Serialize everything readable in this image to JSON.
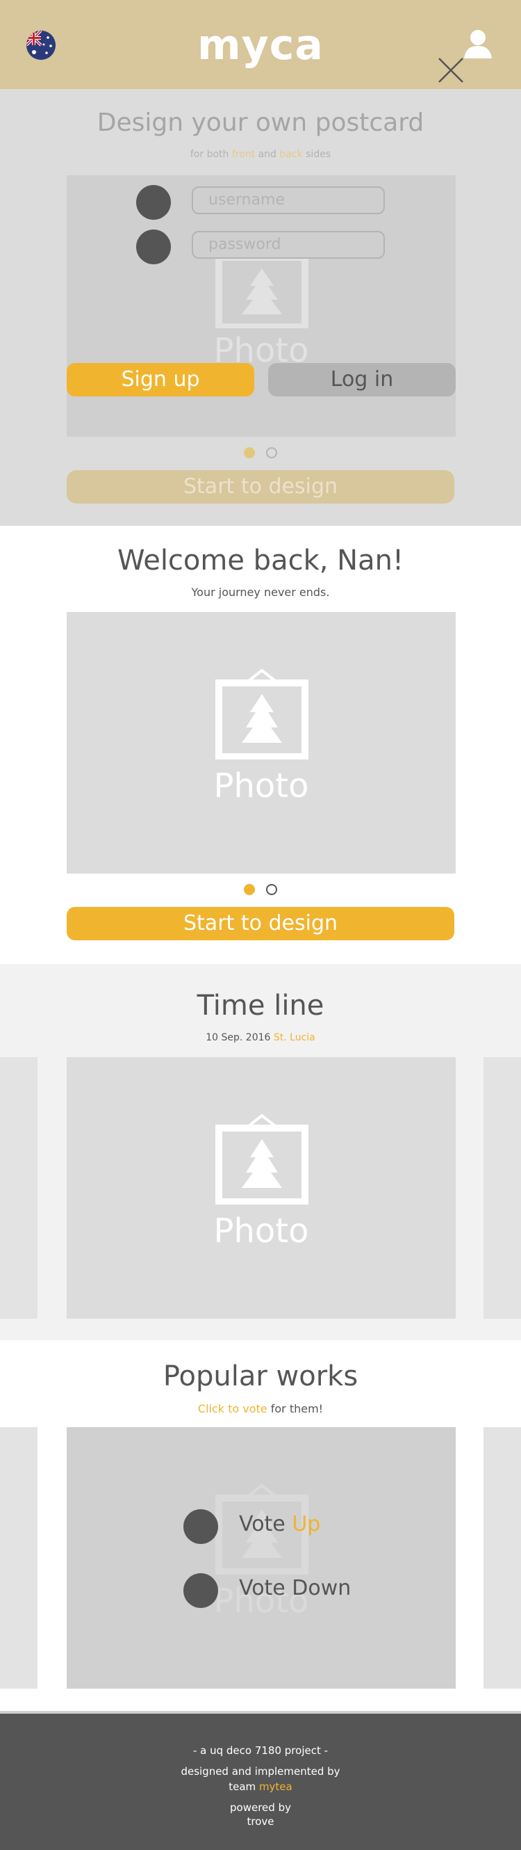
{
  "header": {
    "logo_text": "myca",
    "flag_icon": "australia-flag-icon",
    "user_icon": "user-icon",
    "background": "#d8c69c"
  },
  "design": {
    "title": "Design your own postcard",
    "subtitle_prefix": "for both ",
    "subtitle_front": "front",
    "subtitle_and": " and ",
    "subtitle_back": "back",
    "subtitle_suffix": " sides",
    "username_placeholder": "username",
    "password_placeholder": "password",
    "photo_label": "Photo",
    "signup_label": "Sign up",
    "login_label": "Log in",
    "start_label": "Start to design",
    "close_icon": "close-icon"
  },
  "welcome": {
    "title": "Welcome back, Nan!",
    "subtitle": "Your journey never ends.",
    "photo_label": "Photo",
    "start_label": "Start to design"
  },
  "timeline": {
    "title": "Time line",
    "date": "10 Sep. 2016 ",
    "place": "St. Lucia",
    "photo_label": "Photo"
  },
  "popular": {
    "title": "Popular works",
    "sub_link": "Click to vote",
    "sub_rest": " for them!",
    "photo_label": "Photo",
    "vote_up_prefix": "Vote ",
    "vote_up_word": "Up",
    "vote_down": "Vote Down"
  },
  "footer": {
    "line1": "- a uq deco 7180 project -",
    "line2": "designed and implemented by",
    "line3_prefix": "team ",
    "line3_team": "mytea",
    "line4": "powered by",
    "line5": "trove"
  },
  "colors": {
    "accent": "#f0b42e",
    "header": "#d8c69c",
    "dark": "#555555",
    "photo_bg": "#dcdcdc"
  }
}
